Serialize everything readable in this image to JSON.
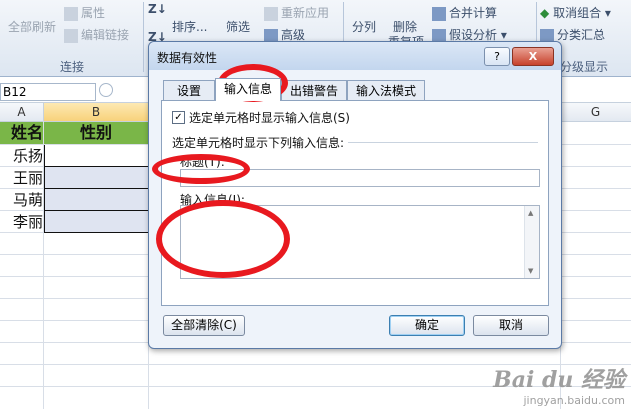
{
  "ribbon": {
    "refresh_all": "全部刷新",
    "properties": "属性",
    "edit_links": "编辑链接",
    "connections_group": "连接",
    "sort": "排序...",
    "filter": "筛选",
    "reapply": "重新应用",
    "advanced": "高级",
    "split_columns": "分列",
    "remove_duplicates": "删除",
    "remove_duplicates_2": "重复项",
    "consolidate": "合并计算",
    "what_if": "假设分析",
    "ungroup": "取消组合",
    "subtotal": "分类汇总",
    "outline_group": "分级显示"
  },
  "formula_bar": {
    "name_box": "B12"
  },
  "columns": {
    "a": "A",
    "b": "B",
    "g": "G"
  },
  "sheet": {
    "header_name": "姓名",
    "header_gender": "性别",
    "rows": [
      "乐扬",
      "王丽",
      "马萌",
      "李丽"
    ]
  },
  "dialog": {
    "title": "数据有效性",
    "help_button": "?",
    "close_button": "X",
    "tabs": [
      "设置",
      "输入信息",
      "出错警告",
      "输入法模式"
    ],
    "active_tab": "输入信息",
    "show_checkbox": "选定单元格时显示输入信息(S)",
    "section_label": "选定单元格时显示下列输入信息:",
    "title_label": "标题(T):",
    "title_value": "",
    "message_label": "输入信息(I):",
    "message_value": "",
    "clear_all": "全部清除(C)",
    "ok": "确定",
    "cancel": "取消"
  },
  "watermark": {
    "logo": "Bai du 经验",
    "url": "jingyan.baidu.com"
  },
  "colors": {
    "header_green": "#7ab648",
    "annotation_red": "#e8191f"
  }
}
